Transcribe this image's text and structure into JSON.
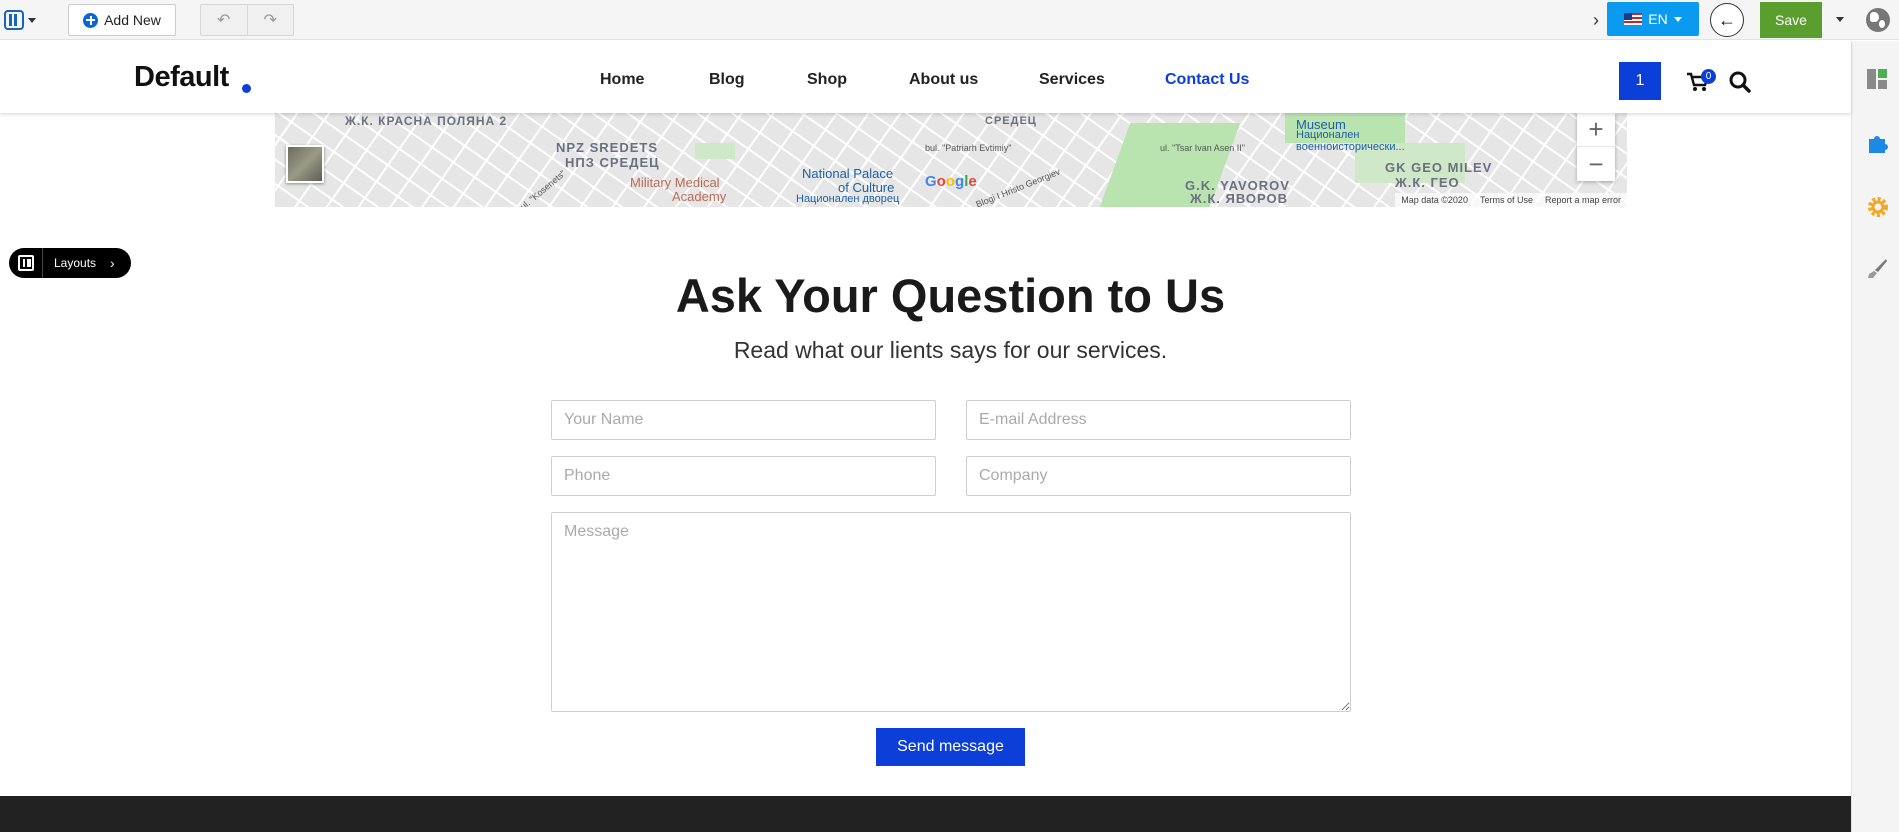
{
  "editor": {
    "add_new_label": "Add New",
    "language_label": "EN",
    "save_label": "Save"
  },
  "site": {
    "brand": "Default",
    "nav": [
      "Home",
      "Blog",
      "Shop",
      "About us",
      "Services",
      "Contact Us"
    ],
    "active_nav": "Contact Us",
    "badge_number": "1",
    "cart_count": "0",
    "accent_color": "#0b3fd8"
  },
  "map": {
    "labels": {
      "poliana": "Ж.К. КРАСНА ПОЛЯНА 2",
      "npz_latin": "NPZ SREDETS",
      "npz_cyr": "НПЗ СРЕДЕЦ",
      "sredets": "СРЕДЕЦ",
      "military": "Military Medical",
      "academy": "Academy",
      "palace": "National Palace",
      "of_culture": "of Culture",
      "palace_cyr": "Национален дворец",
      "museum": "Museum",
      "museum_cyr": "Национален военноисторически...",
      "geo_milev_latin": "GK GEO MILEV",
      "geo_milev_cyr": "Ж.К. ГЕО",
      "yavorov_latin": "G.K. YAVOROV",
      "yavorov_cyr": "Ж.К. ЯВОРОВ",
      "patriarh": "bul. \"Patriarh Evtimiy\"",
      "ivan_asen": "ul. \"Tsar Ivan Asen II\"",
      "hristo": "Blogi I Hristo Georgiev",
      "kosenets": "ul. \"Kosenets\""
    },
    "zoom_in": "+",
    "zoom_out": "−",
    "footer": [
      "Map data ©2020",
      "Terms of Use",
      "Report a map error"
    ],
    "google_letters": [
      "G",
      "o",
      "o",
      "g",
      "l",
      "e"
    ]
  },
  "layouts_label": "Layouts",
  "contact": {
    "heading": "Ask Your Question to Us",
    "subheading": "Read what our lients says for our services.",
    "fields": {
      "name": "Your Name",
      "email": "E-mail Address",
      "phone": "Phone",
      "company": "Company",
      "message": "Message"
    },
    "send_label": "Send message"
  }
}
